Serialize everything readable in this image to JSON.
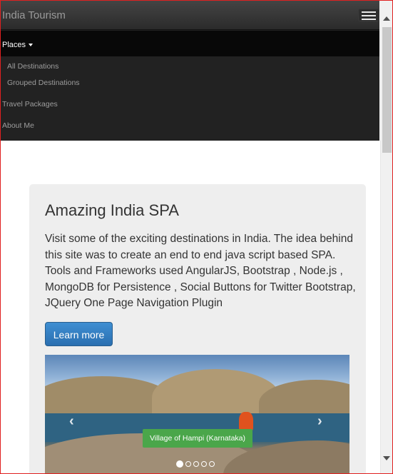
{
  "navbar": {
    "brand": "India Tourism",
    "toggle_icon": "hamburger-icon",
    "places_label": "Places",
    "dropdown": [
      {
        "label": "All Destinations"
      },
      {
        "label": "Grouped Destinations"
      }
    ],
    "travel_packages": "Travel Packages",
    "about_me": "About Me"
  },
  "jumbotron": {
    "title": "Amazing India SPA",
    "description": "Visit some of the exciting destinations in India. The idea behind this site was to create an end to end java script based SPA. Tools and Frameworks used AngularJS, Bootstrap , Node.js , MongoDB for Persistence , Social Buttons for Twitter Bootstrap, JQuery One Page Navigation Plugin",
    "button_label": "Learn more"
  },
  "carousel": {
    "caption": "Village of Hampi (Karnataka)",
    "prev_icon": "chevron-left-icon",
    "next_icon": "chevron-right-icon",
    "slide_count": 5,
    "active_index": 0
  },
  "colors": {
    "navbar_bg": "#222222",
    "button_primary": "#337ab7",
    "caption_bg": "#4aa64a",
    "jumbotron_bg": "#eeeeee"
  }
}
